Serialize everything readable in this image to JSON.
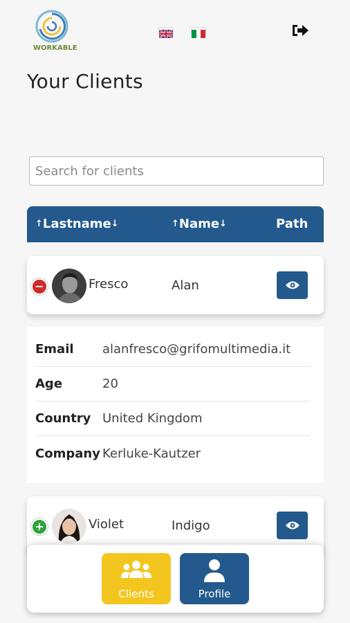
{
  "header": {
    "logo_text": "WORKABLE",
    "languages": [
      "English",
      "Italian"
    ]
  },
  "page": {
    "title": "Your Clients"
  },
  "search": {
    "placeholder": "Search for clients"
  },
  "table": {
    "columns": [
      {
        "label": "Lastname",
        "sort_up": "↑",
        "sort_down": "↓"
      },
      {
        "label": "Name",
        "sort_up": "↑",
        "sort_down": "↓"
      },
      {
        "label": "Path"
      }
    ],
    "rows": [
      {
        "lastname": "Fresco",
        "name": "Alan",
        "expanded": true,
        "toggle_symbol": "−",
        "details": [
          {
            "label": "Email",
            "value": "alanfresco@grifomultimedia.it"
          },
          {
            "label": "Age",
            "value": "20"
          },
          {
            "label": "Country",
            "value": "United Kingdom"
          },
          {
            "label": "Company",
            "value": "Kerluke-Kautzer"
          }
        ]
      },
      {
        "lastname": "Violet",
        "name": "Indigo",
        "expanded": false,
        "toggle_symbol": "+"
      }
    ]
  },
  "bottom_nav": {
    "clients_label": "Clients",
    "profile_label": "Profile",
    "active": "Clients"
  },
  "colors": {
    "primary": "#23598d",
    "accent": "#f3c51f",
    "remove": "#cf2a2a",
    "add": "#2fa43a"
  },
  "icons": {
    "logout": "logout-icon",
    "view": "eye-icon",
    "clients": "users-group-icon",
    "profile": "user-icon"
  }
}
